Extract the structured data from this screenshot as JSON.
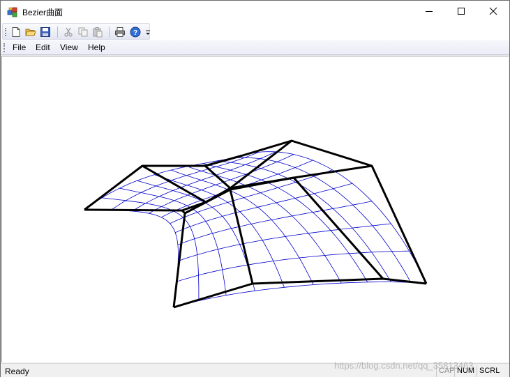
{
  "window": {
    "title": "Bezier曲面",
    "controls": {
      "minimize": "minimize",
      "maximize": "maximize",
      "close": "close"
    }
  },
  "toolbar": {
    "buttons": [
      {
        "name": "new-file",
        "icon": "new-document-icon"
      },
      {
        "name": "open",
        "icon": "open-folder-icon"
      },
      {
        "name": "save",
        "icon": "floppy-disk-icon"
      },
      {
        "name": "cut",
        "icon": "scissors-icon"
      },
      {
        "name": "copy",
        "icon": "copy-icon"
      },
      {
        "name": "paste",
        "icon": "paste-icon"
      },
      {
        "name": "print",
        "icon": "printer-icon"
      },
      {
        "name": "about",
        "icon": "help-icon"
      }
    ]
  },
  "menu": {
    "items": [
      {
        "label": "File"
      },
      {
        "label": "Edit"
      },
      {
        "label": "View"
      },
      {
        "label": "Help"
      }
    ]
  },
  "canvas": {
    "control_net_color": "#000000",
    "surface_mesh_color": "#0000cc"
  },
  "statusbar": {
    "message": "Ready",
    "indicators": {
      "cap": "CAP",
      "num": "NUM",
      "scrl": "SCRL"
    }
  },
  "watermark": "https://blog.csdn.net/qq_35813463"
}
